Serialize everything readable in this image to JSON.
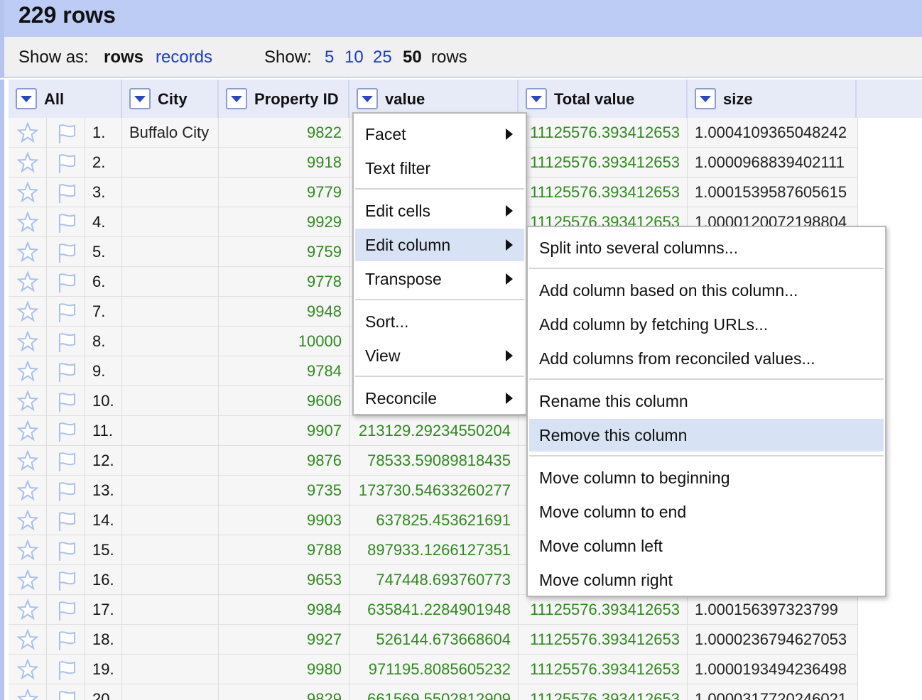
{
  "header": {
    "row_count": "229 rows"
  },
  "show_bar": {
    "show_as_label": "Show as:",
    "mode_rows": "rows",
    "mode_records": "records",
    "show_label": "Show:",
    "page_sizes": [
      "5",
      "10",
      "25",
      "50"
    ],
    "selected_page_size": "50",
    "rows_suffix": "rows"
  },
  "columns": [
    "All",
    "City",
    "Property ID",
    "value",
    "Total value",
    "size"
  ],
  "rows": [
    {
      "n": "1.",
      "city": "Buffalo City",
      "pid": "9822",
      "value": "",
      "total": "11125576.393412653",
      "size": "1.0004109365048242"
    },
    {
      "n": "2.",
      "city": "",
      "pid": "9918",
      "value": "",
      "total": "11125576.393412653",
      "size": "1.0000968839402111"
    },
    {
      "n": "3.",
      "city": "",
      "pid": "9779",
      "value": "",
      "total": "11125576.393412653",
      "size": "1.0001539587605615"
    },
    {
      "n": "4.",
      "city": "",
      "pid": "9929",
      "value": "",
      "total": "11125576.393412653",
      "size": "1.0000120072198804"
    },
    {
      "n": "5.",
      "city": "",
      "pid": "9759",
      "value": "",
      "total": "",
      "size": ""
    },
    {
      "n": "6.",
      "city": "",
      "pid": "9778",
      "value": "",
      "total": "",
      "size": ""
    },
    {
      "n": "7.",
      "city": "",
      "pid": "9948",
      "value": "",
      "total": "",
      "size": ""
    },
    {
      "n": "8.",
      "city": "",
      "pid": "10000",
      "value": "",
      "total": "",
      "size": ""
    },
    {
      "n": "9.",
      "city": "",
      "pid": "9784",
      "value": "",
      "total": "",
      "size": ""
    },
    {
      "n": "10.",
      "city": "",
      "pid": "9606",
      "value": "",
      "total": "",
      "size": ""
    },
    {
      "n": "11.",
      "city": "",
      "pid": "9907",
      "value": "213129.29234550204",
      "total": "",
      "size": ""
    },
    {
      "n": "12.",
      "city": "",
      "pid": "9876",
      "value": "78533.59089818435",
      "total": "",
      "size": ""
    },
    {
      "n": "13.",
      "city": "",
      "pid": "9735",
      "value": "173730.54633260277",
      "total": "",
      "size": ""
    },
    {
      "n": "14.",
      "city": "",
      "pid": "9903",
      "value": "637825.453621691",
      "total": "",
      "size": ""
    },
    {
      "n": "15.",
      "city": "",
      "pid": "9788",
      "value": "897933.1266127351",
      "total": "",
      "size": ""
    },
    {
      "n": "16.",
      "city": "",
      "pid": "9653",
      "value": "747448.693760773",
      "total": "",
      "size": ""
    },
    {
      "n": "17.",
      "city": "",
      "pid": "9984",
      "value": "635841.2284901948",
      "total": "11125576.393412653",
      "size": "1.000156397323799"
    },
    {
      "n": "18.",
      "city": "",
      "pid": "9927",
      "value": "526144.673668604",
      "total": "11125576.393412653",
      "size": "1.0000236794627053"
    },
    {
      "n": "19.",
      "city": "",
      "pid": "9980",
      "value": "971195.8085605232",
      "total": "11125576.393412653",
      "size": "1.0000193494236498"
    },
    {
      "n": "20.",
      "city": "",
      "pid": "9829",
      "value": "661569.5502812909",
      "total": "11125576.393412653",
      "size": "1.0000317720246021"
    }
  ],
  "column_menu": [
    {
      "label": "Facet",
      "submenu": true
    },
    {
      "label": "Text filter",
      "submenu": false
    },
    {
      "sep": true
    },
    {
      "label": "Edit cells",
      "submenu": true
    },
    {
      "label": "Edit column",
      "submenu": true,
      "highlighted": true
    },
    {
      "label": "Transpose",
      "submenu": true
    },
    {
      "sep": true
    },
    {
      "label": "Sort...",
      "submenu": false
    },
    {
      "label": "View",
      "submenu": true
    },
    {
      "sep": true
    },
    {
      "label": "Reconcile",
      "submenu": true
    }
  ],
  "edit_column_menu": [
    {
      "label": "Split into several columns..."
    },
    {
      "sep": true
    },
    {
      "label": "Add column based on this column..."
    },
    {
      "label": "Add column by fetching URLs..."
    },
    {
      "label": "Add columns from reconciled values..."
    },
    {
      "sep": true
    },
    {
      "label": "Rename this column"
    },
    {
      "label": "Remove this column",
      "highlighted": true
    },
    {
      "sep": true
    },
    {
      "label": "Move column to beginning"
    },
    {
      "label": "Move column to end"
    },
    {
      "label": "Move column left"
    },
    {
      "label": "Move column right"
    }
  ],
  "colors": {
    "number_green": "#2f8a1e",
    "link_blue": "#1a3bcf",
    "header_bg": "#bcccf5",
    "menu_highlight": "#d8e2f5"
  }
}
